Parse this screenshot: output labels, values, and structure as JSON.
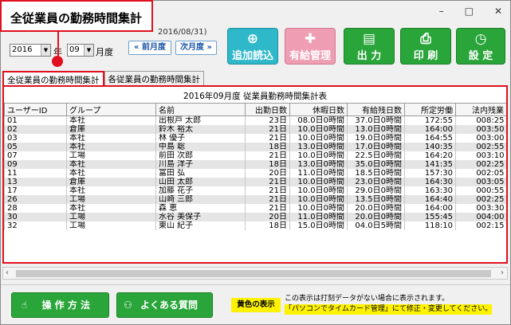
{
  "callout": {
    "label": "全従業員の勤務時間集計"
  },
  "window": {
    "minimize": "–",
    "maximize": "□",
    "close": "✕"
  },
  "date_hint": "2016/08/31)",
  "period": {
    "year": "2016",
    "month": "09",
    "year_label": "年",
    "month_label": "月度",
    "prev_month": "« 前月度",
    "next_month": "次月度 »"
  },
  "toolbar": {
    "add_load": "追加読込",
    "paid_leave": "有給管理",
    "output": "出 力",
    "print": "印 刷",
    "settings": "設 定"
  },
  "tabs": [
    "全従業員の勤務時間集計",
    "各従業員の勤務時間集計"
  ],
  "table": {
    "title": "2016年09月度 従業員勤務時間集計表",
    "headers": [
      "ユーザーID",
      "グループ",
      "名前",
      "出勤日数",
      "休暇日数",
      "有給残日数",
      "所定労働",
      "法内残業"
    ],
    "rows": [
      [
        "01",
        "本社",
        "出根戸 太郎",
        "23日",
        "08.0日0時間",
        "37.0日0時間",
        "172:55",
        "008:25"
      ],
      [
        "02",
        "倉庫",
        "鈴木 裕太",
        "21日",
        "10.0日0時間",
        "13.0日0時間",
        "164:00",
        "003:50"
      ],
      [
        "03",
        "本社",
        "林 優子",
        "21日",
        "10.0日0時間",
        "19.0日0時間",
        "164:55",
        "003:00"
      ],
      [
        "05",
        "本社",
        "中島 聡",
        "18日",
        "13.0日0時間",
        "17.0日0時間",
        "140:35",
        "002:55"
      ],
      [
        "07",
        "工場",
        "前田 次郎",
        "21日",
        "10.0日0時間",
        "22.5日0時間",
        "164:20",
        "003:10"
      ],
      [
        "09",
        "本社",
        "川島 洋子",
        "18日",
        "13.0日0時間",
        "35.0日0時間",
        "141:35",
        "002:25"
      ],
      [
        "11",
        "本社",
        "富田 弘",
        "20日",
        "11.0日0時間",
        "18.5日0時間",
        "157:30",
        "002:05"
      ],
      [
        "13",
        "倉庫",
        "山田 太郎",
        "21日",
        "10.0日0時間",
        "23.0日0時間",
        "164:30",
        "003:05"
      ],
      [
        "17",
        "本社",
        "加藤 花子",
        "21日",
        "10.0日0時間",
        "29.0日0時間",
        "163:30",
        "000:55"
      ],
      [
        "26",
        "工場",
        "山崎 三郎",
        "21日",
        "10.0日0時間",
        "13.5日0時間",
        "164:40",
        "002:25"
      ],
      [
        "28",
        "本社",
        "森 恵",
        "21日",
        "10.0日0時間",
        "20.0日0時間",
        "164:00",
        "003:30"
      ],
      [
        "30",
        "工場",
        "水谷 美保子",
        "20日",
        "11.0日0時間",
        "20.0日0時間",
        "155:45",
        "004:00"
      ],
      [
        "32",
        "工場",
        "東山 紀子",
        "18日",
        "15.0日0時間",
        "04.0日5時間",
        "118:10",
        "002:15"
      ]
    ]
  },
  "bottom": {
    "howto": "操 作 方 法",
    "faq": "よくある質問",
    "yellow_label": "黄色の表示",
    "note_line1": "この表示は打刻データがない場合に表示されます。",
    "note_line2": "「パソコンでタイムカード管理」にて修正・変更してください。"
  },
  "colors": {
    "accent_red": "#e0101e",
    "green": "#2aa53a",
    "cyan": "#2fb8c9",
    "pink": "#ee9db3",
    "yellow": "#fff200"
  },
  "icons": [
    "add-document-icon",
    "paid-leave-icon",
    "output-icon",
    "printer-icon",
    "settings-clock-icon",
    "hand-pointer-icon",
    "question-answer-icon"
  ]
}
